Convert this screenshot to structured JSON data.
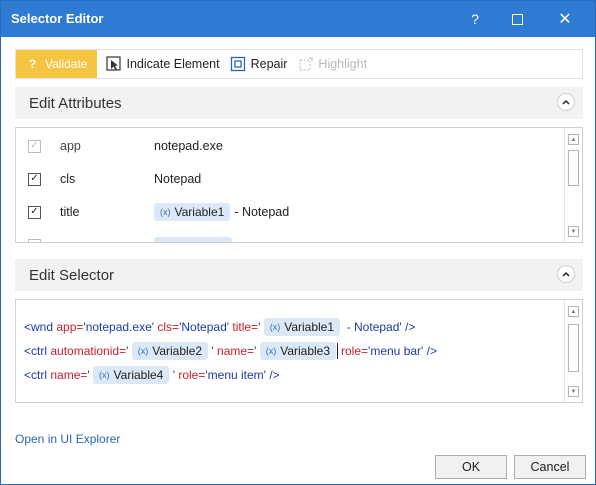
{
  "window": {
    "title": "Selector Editor",
    "help": "?",
    "close": "✕"
  },
  "toolbar": {
    "validate": "Validate",
    "indicate": "Indicate Element",
    "repair": "Repair",
    "highlight": "Highlight"
  },
  "attributes": {
    "header": "Edit Attributes",
    "rows": [
      {
        "name": "app",
        "value": "notepad.exe",
        "checked": true,
        "enabled": false
      },
      {
        "name": "cls",
        "value": "Notepad",
        "checked": true,
        "enabled": true
      },
      {
        "name": "title",
        "variable": "Variable1",
        "suffix": "- Notepad",
        "checked": true,
        "enabled": true
      }
    ]
  },
  "selector": {
    "header": "Edit Selector",
    "line1": {
      "tag": "<wnd",
      "a1": "app=",
      "v1": "'notepad.exe'",
      "a2": "cls=",
      "v2": "'Notepad'",
      "a3": "title=",
      "v3a": "'",
      "var": "Variable1",
      "v3b": "- Notepad'",
      "end": "/>"
    },
    "line2": {
      "tag": "<ctrl",
      "a1": "automationid=",
      "v1a": "'",
      "var1": "Variable2",
      "v1b": "'",
      "a2": "name=",
      "v2a": "'",
      "var2": "Variable3",
      "a3": "role=",
      "v3": "'menu bar'",
      "end": "/>"
    },
    "line3": {
      "tag": "<ctrl",
      "a1": "name=",
      "v1a": "'",
      "var": "Variable4",
      "v1b": "'",
      "a2": "role=",
      "v2": "'menu item'",
      "end": "/>"
    }
  },
  "footer": {
    "link": "Open in UI Explorer",
    "ok": "OK",
    "cancel": "Cancel"
  },
  "colors": {
    "titlebar": "#2f7ad3",
    "validate": "#f5c542",
    "tag": "#1d3aa8",
    "attr": "#c8202b",
    "chip": "#dbe8f6"
  }
}
